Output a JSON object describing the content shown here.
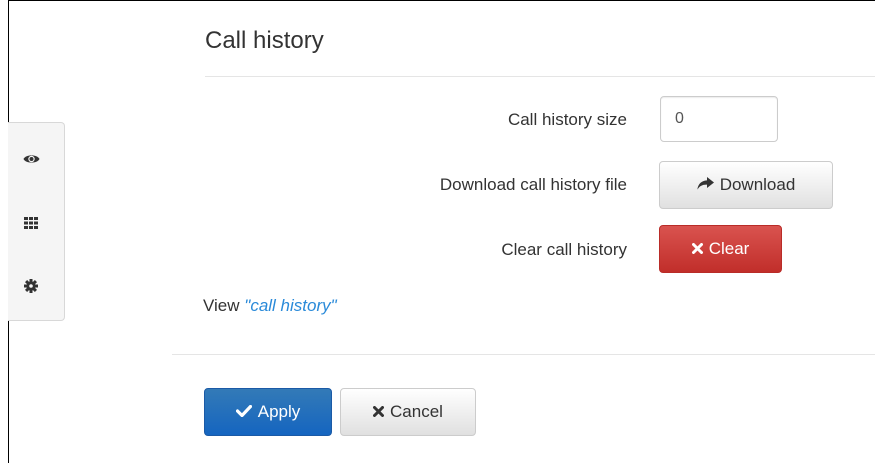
{
  "page": {
    "title": "Call history"
  },
  "sidebar": {
    "items": [
      {
        "icon": "eye-icon"
      },
      {
        "icon": "grid-icon"
      },
      {
        "icon": "gear-icon"
      }
    ]
  },
  "form": {
    "history_size": {
      "label": "Call history size",
      "value": "0"
    },
    "download": {
      "label": "Download call history file",
      "button_label": "Download",
      "icon": "share-arrow-icon"
    },
    "clear": {
      "label": "Clear call history",
      "button_label": "Clear",
      "icon": "close-icon"
    },
    "view": {
      "prefix": "View",
      "link_text": "\"call history\""
    }
  },
  "footer": {
    "apply_label": "Apply",
    "apply_icon": "check-icon",
    "cancel_label": "Cancel",
    "cancel_icon": "close-icon"
  },
  "colors": {
    "primary": "#337ab7",
    "danger": "#d9534f",
    "link": "#2a8ad9"
  }
}
